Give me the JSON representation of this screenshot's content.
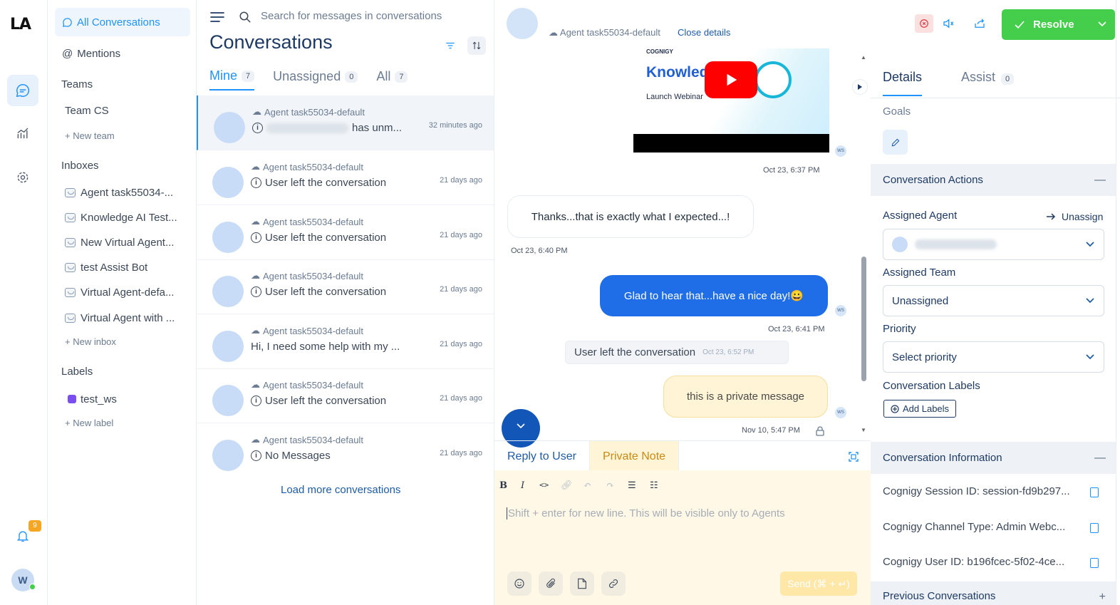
{
  "rail": {
    "logo": "LA",
    "notification_count": "9",
    "user_initials": "W"
  },
  "sidebar": {
    "all_conversations": "All Conversations",
    "mentions": "Mentions",
    "teams_heading": "Teams",
    "teams": [
      "Team CS"
    ],
    "new_team": "New team",
    "inboxes_heading": "Inboxes",
    "inboxes": [
      "Agent task55034-...",
      "Knowledge AI Test...",
      "New Virtual Agent...",
      "test Assist Bot",
      "Virtual Agent-defa...",
      "Virtual Agent with ..."
    ],
    "new_inbox": "New inbox",
    "labels_heading": "Labels",
    "labels": [
      "test_ws"
    ],
    "new_label": "New label"
  },
  "convlist": {
    "search_placeholder": "Search for messages in conversations",
    "title": "Conversations",
    "tabs": [
      {
        "label": "Mine",
        "count": "7"
      },
      {
        "label": "Unassigned",
        "count": "0"
      },
      {
        "label": "All",
        "count": "7"
      }
    ],
    "rows": [
      {
        "inbox": "Agent task55034-default",
        "message": "has unm...",
        "time": "32 minutes ago"
      },
      {
        "inbox": "Agent task55034-default",
        "message": "User left the conversation",
        "time": "21 days ago"
      },
      {
        "inbox": "Agent task55034-default",
        "message": "User left the conversation",
        "time": "21 days ago"
      },
      {
        "inbox": "Agent task55034-default",
        "message": "User left the conversation",
        "time": "21 days ago"
      },
      {
        "inbox": "Agent task55034-default",
        "message": "Hi, I need some help with my ...",
        "time": "21 days ago"
      },
      {
        "inbox": "Agent task55034-default",
        "message": "User left the conversation",
        "time": "21 days ago"
      },
      {
        "inbox": "Agent task55034-default",
        "message": "No Messages",
        "time": "21 days ago"
      }
    ],
    "load_more": "Load more conversations"
  },
  "chat": {
    "inbox": "Agent task55034-default",
    "close_details": "Close details",
    "resolve": "Resolve",
    "video": {
      "brand": "COGNIGY",
      "title": "Knowled",
      "subtitle": "Launch Webinar"
    },
    "messages": [
      {
        "text": "",
        "time": "Oct 23, 6:37 PM"
      },
      {
        "text": "Thanks...that is exactly what I expected...!",
        "time": "Oct 23, 6:40 PM"
      },
      {
        "text": "Glad to hear that...have a nice day!😀",
        "time": "Oct 23, 6:41 PM"
      },
      {
        "text": "User left the conversation",
        "time": "Oct 23, 6:52 PM"
      },
      {
        "text": "this is a private message",
        "time": "Nov 10, 5:47 PM"
      }
    ],
    "avatar_initials": "WS",
    "reply_tab": "Reply to User",
    "private_tab": "Private Note",
    "editor_placeholder": "Shift + enter for new line. This will be visible only to Agents",
    "send_label": "Send (⌘ + ↵)"
  },
  "right": {
    "tabs": [
      {
        "label": "Details"
      },
      {
        "label": "Assist",
        "count": "0"
      }
    ],
    "goals": "Goals",
    "actions_title": "Conversation Actions",
    "assigned_agent": "Assigned Agent",
    "unassign": "Unassign",
    "assigned_team": "Assigned Team",
    "team_value": "Unassigned",
    "priority": "Priority",
    "priority_value": "Select priority",
    "labels": "Conversation Labels",
    "add_labels": "Add Labels",
    "info_title": "Conversation Information",
    "info": [
      "Cognigy Session ID: session-fd9b297...",
      "Cognigy Channel Type: Admin Webc...",
      "Cognigy User ID: b196fcec-5f02-4ce..."
    ],
    "previous": "Previous Conversations"
  },
  "colors": {
    "accent": "#1f93ff",
    "resolve": "#44ce4b",
    "bubble_out": "#1f6ee8",
    "private_bg": "#fff8e6"
  }
}
